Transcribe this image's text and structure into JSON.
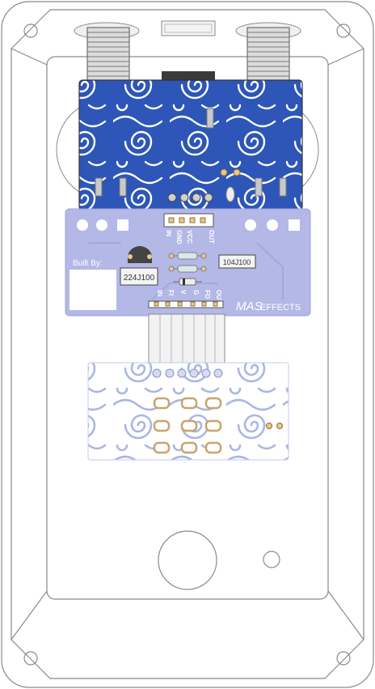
{
  "board": {
    "built_by_label": "Built By:",
    "pin_labels_top": [
      "IN",
      "GND",
      "VCC",
      "OUT"
    ],
    "pin_labels_bottom": [
      "IN",
      "FI",
      "V",
      "G",
      "FO",
      "OUT"
    ],
    "capacitor_left": "224J100",
    "capacitor_right": "104J100",
    "brand_mark": "MAS",
    "brand_word": "EFFECTS"
  },
  "colors": {
    "board": "#b3b8e6",
    "swirl_dark": "#2d56b8",
    "swirl_light": "#a9b7e4",
    "outline": "#8a8a8a",
    "pad": "#e8c98a"
  }
}
